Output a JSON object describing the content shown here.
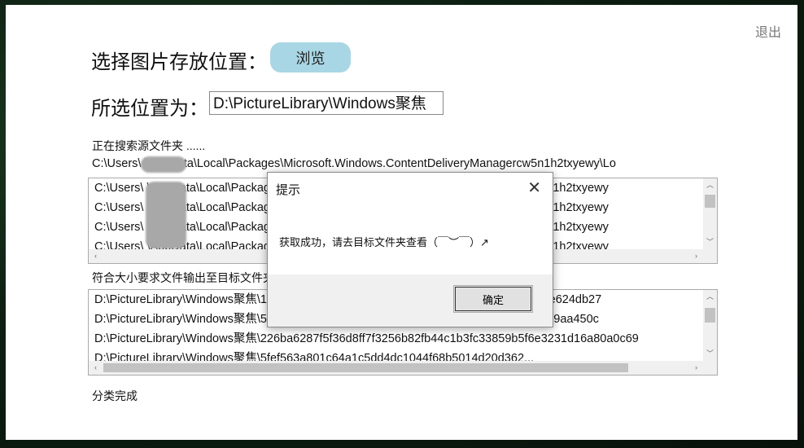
{
  "window": {
    "exit_label": "退出"
  },
  "save_row": {
    "label": "选择图片存放位置：",
    "browse_label": "浏览"
  },
  "selected_row": {
    "label": "所选位置为：",
    "path_value": "D:\\PictureLibrary\\Windows聚焦"
  },
  "search": {
    "status": "正在搜索源文件夹 ......",
    "current_path": "C:\\Users\\        \\AppData\\Local\\Packages\\Microsoft.Windows.ContentDeliveryManagercw5n1h2txyewy\\Lo"
  },
  "source_list": {
    "items": [
      "C:\\Users\\        \\AppData\\Local\\Packages\\Microsoft.Windows.ContentDeliveryManager_cw5n1h2txyewy",
      "C:\\Users\\        \\AppData\\Local\\Packages\\Microsoft.Windows.ContentDeliveryManager_cw5n1h2txyewy",
      "C:\\Users\\        \\AppData\\Local\\Packages\\Microsoft.Windows.ContentDeliveryManager_cw5n1h2txyewy",
      "C:\\Users\\        \\AppData\\Local\\Packages\\Microsoft.Windows.ContentDeliveryManager_cw5n1h2txyewy"
    ]
  },
  "output": {
    "label": "符合大小要求文件输出至目标文件夹："
  },
  "output_list": {
    "items": [
      "D:\\PictureLibrary\\Windows聚焦\\1b4bb0c1a8d7f5e2c3b4a5f6e7d8c9b0a8d17b1c5c9bf7e624db27",
      "D:\\PictureLibrary\\Windows聚焦\\5c2f8a1b9e3d7c6f4a0b2e8d1c9f7a3b530f91022b33e819aa450c",
      "D:\\PictureLibrary\\Windows聚焦\\226ba6287f5f36d8ff7f3256b82fb44c1b3fc33859b5f6e3231d16a80a0c69",
      "D:\\PictureLibrary\\Windows聚焦\\5fef563a801c64a1c5dd4dc1044f68b5014d20d362... "
    ]
  },
  "status": {
    "done_text": "分类完成"
  },
  "dialog": {
    "title": "提示",
    "message": "获取成功，请去目标文件夹查看（￣︶￣）↗",
    "ok_label": "确定"
  }
}
